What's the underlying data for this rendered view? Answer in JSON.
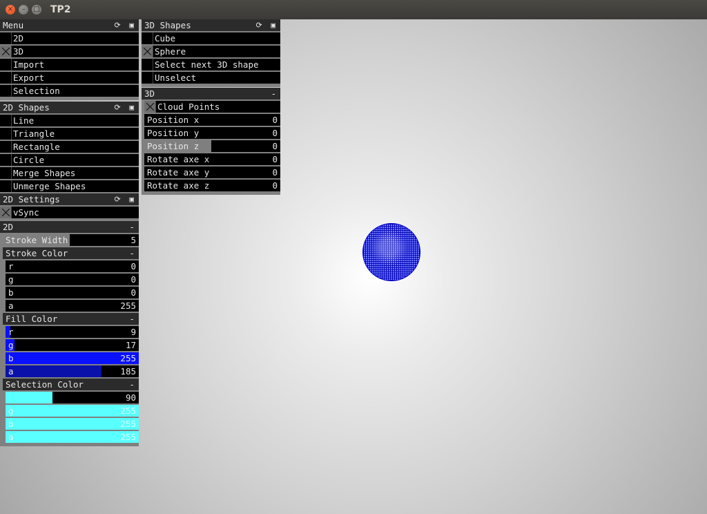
{
  "window": {
    "title": "TP2",
    "close": "×",
    "minimize": "–",
    "maximize": "□"
  },
  "colors": {
    "blue_fill": "#0911ff",
    "cyan": "#5affff",
    "slider_gray": "#7f7f7f",
    "sphere": "#0000ff"
  },
  "menu": {
    "title": "Menu",
    "items": [
      {
        "label": "2D",
        "checked": false
      },
      {
        "label": "3D",
        "checked": true
      },
      {
        "label": "Import",
        "checked": false
      },
      {
        "label": "Export",
        "checked": false
      },
      {
        "label": "Selection",
        "checked": false
      }
    ]
  },
  "shapes2d": {
    "title": "2D Shapes",
    "items": [
      {
        "label": "Line"
      },
      {
        "label": "Triangle"
      },
      {
        "label": "Rectangle"
      },
      {
        "label": "Circle"
      },
      {
        "label": "Merge Shapes"
      },
      {
        "label": "Unmerge Shapes"
      }
    ]
  },
  "settings2d": {
    "title": "2D Settings",
    "vsync": {
      "label": "vSync",
      "checked": true
    },
    "group_title": "2D",
    "collapse": "-",
    "stroke_width": {
      "label": "Stroke Width",
      "value": "5",
      "fraction": 0.5
    },
    "stroke_color": {
      "title": "Stroke Color",
      "r": {
        "label": "r",
        "value": "0"
      },
      "g": {
        "label": "g",
        "value": "0"
      },
      "b": {
        "label": "b",
        "value": "0"
      },
      "a": {
        "label": "a",
        "value": "255"
      }
    },
    "fill_color": {
      "title": "Fill Color",
      "r": {
        "label": "r",
        "value": "9"
      },
      "g": {
        "label": "g",
        "value": "17"
      },
      "b": {
        "label": "b",
        "value": "255"
      },
      "a": {
        "label": "a",
        "value": "185"
      }
    },
    "selection_color": {
      "title": "Selection Color",
      "r": {
        "label": "r",
        "value": "90"
      },
      "g": {
        "label": "g",
        "value": "255"
      },
      "b": {
        "label": "b",
        "value": "255"
      },
      "a": {
        "label": "a",
        "value": "255"
      }
    }
  },
  "shapes3d": {
    "title": "3D Shapes",
    "items": [
      {
        "label": "Cube",
        "checked": false
      },
      {
        "label": "Sphere",
        "checked": true
      },
      {
        "label": "Select next 3D shape",
        "checked": false
      },
      {
        "label": "Unselect",
        "checked": false
      }
    ]
  },
  "settings3d": {
    "title": "3D",
    "collapse": "-",
    "cloud_points": {
      "label": "Cloud Points",
      "checked": true
    },
    "sliders": [
      {
        "label": "Position x",
        "value": "0",
        "fraction": 0
      },
      {
        "label": "Position y",
        "value": "0",
        "fraction": 0
      },
      {
        "label": "Position z",
        "value": "0",
        "fraction": 0.5
      },
      {
        "label": "Rotate axe x",
        "value": "0",
        "fraction": 0
      },
      {
        "label": "Rotate axe y",
        "value": "0",
        "fraction": 0
      },
      {
        "label": "Rotate axe z",
        "value": "0",
        "fraction": 0
      }
    ]
  },
  "panel_icons": "⟳ ▣"
}
